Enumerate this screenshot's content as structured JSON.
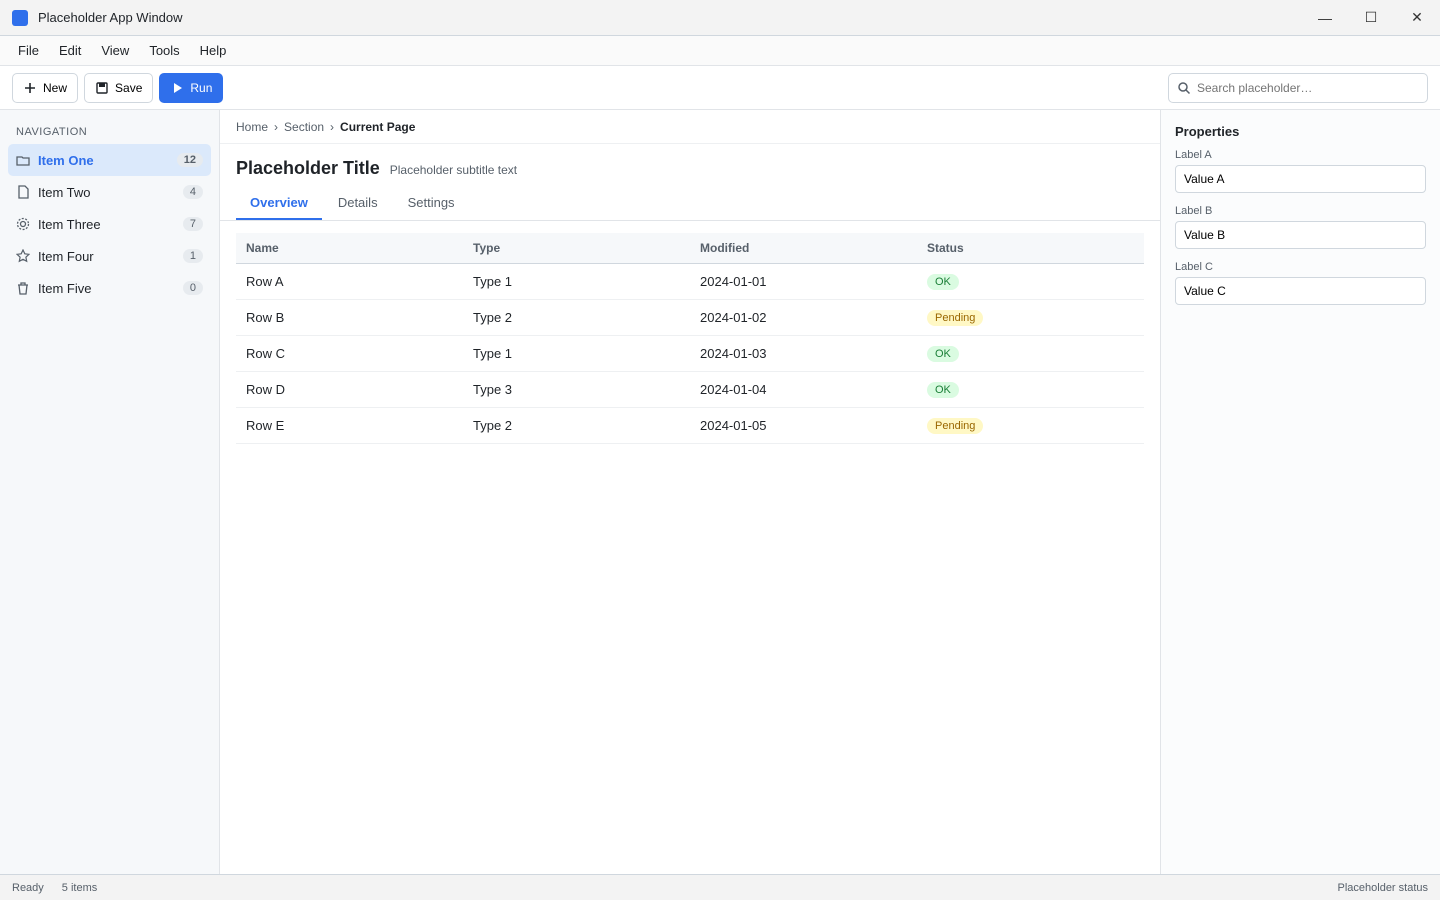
{
  "window": {
    "title": "Placeholder App Window",
    "minimize_glyph": "—",
    "maximize_glyph": "☐",
    "close_glyph": "✕",
    "accent_color": "#2f6feb",
    "app_icon_color": "#2f6feb"
  },
  "menu": [
    "File",
    "Edit",
    "View",
    "Tools",
    "Help"
  ],
  "toolbar": {
    "new_label": "New",
    "save_label": "Save",
    "run_label": "Run",
    "search_placeholder": "Search placeholder…",
    "search_value": ""
  },
  "sidebar": {
    "section_title": "Navigation",
    "items": [
      {
        "label": "Item One",
        "count": "12",
        "icon": "folder-icon"
      },
      {
        "label": "Item Two",
        "count": "4",
        "icon": "file-icon"
      },
      {
        "label": "Item Three",
        "count": "7",
        "icon": "gear-icon"
      },
      {
        "label": "Item Four",
        "count": "1",
        "icon": "star-icon"
      },
      {
        "label": "Item Five",
        "count": "0",
        "icon": "trash-icon"
      }
    ]
  },
  "breadcrumb": [
    "Home",
    "Section",
    "Current Page"
  ],
  "page": {
    "title": "Placeholder Title",
    "subtitle": "Placeholder subtitle text"
  },
  "tabs": [
    {
      "label": "Overview"
    },
    {
      "label": "Details"
    },
    {
      "label": "Settings"
    }
  ],
  "table": {
    "columns": [
      "Name",
      "Type",
      "Modified",
      "Status"
    ],
    "rows": [
      [
        "Row A",
        "Type 1",
        "2024-01-01",
        "OK"
      ],
      [
        "Row B",
        "Type 2",
        "2024-01-02",
        "Pending"
      ],
      [
        "Row C",
        "Type 1",
        "2024-01-03",
        "OK"
      ],
      [
        "Row D",
        "Type 3",
        "2024-01-04",
        "OK"
      ],
      [
        "Row E",
        "Type 2",
        "2024-01-05",
        "Pending"
      ]
    ]
  },
  "inspector": {
    "heading": "Properties",
    "fields": [
      {
        "label": "Label A",
        "value": "Value A"
      },
      {
        "label": "Label B",
        "value": "Value B"
      },
      {
        "label": "Label C",
        "value": "Value C"
      }
    ]
  },
  "status": {
    "left": "Ready",
    "middle": "5 items",
    "right": "Placeholder status"
  }
}
